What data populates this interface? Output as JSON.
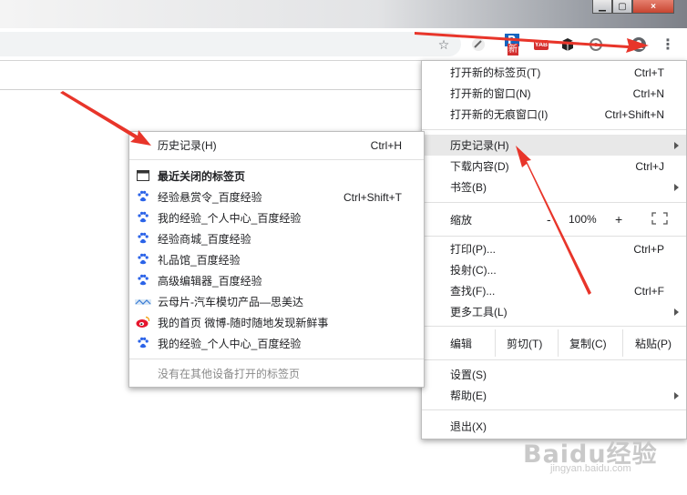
{
  "window": {
    "controls": [
      "minimize",
      "maximize",
      "close"
    ],
    "close_label": "×"
  },
  "toolbar": {
    "icons": [
      "star-icon",
      "ext-pencil-icon",
      "ext-p-icon",
      "ext-yab-icon",
      "ext-cube-icon",
      "ext-circle-icon",
      "profile-icon",
      "menu-icon"
    ],
    "ext_p_badge": "新",
    "ext_yab_label": "YAB",
    "menu_label": "⋮"
  },
  "main_menu": {
    "new_tab": {
      "label": "打开新的标签页(T)",
      "shortcut": "Ctrl+T"
    },
    "new_window": {
      "label": "打开新的窗口(N)",
      "shortcut": "Ctrl+N"
    },
    "new_incognito": {
      "label": "打开新的无痕窗口(I)",
      "shortcut": "Ctrl+Shift+N"
    },
    "history": {
      "label": "历史记录(H)"
    },
    "downloads": {
      "label": "下载内容(D)",
      "shortcut": "Ctrl+J"
    },
    "bookmarks": {
      "label": "书签(B)"
    },
    "zoom": {
      "label": "缩放",
      "minus": "-",
      "value": "100%",
      "plus": "+"
    },
    "print": {
      "label": "打印(P)...",
      "shortcut": "Ctrl+P"
    },
    "cast": {
      "label": "投射(C)..."
    },
    "find": {
      "label": "查找(F)...",
      "shortcut": "Ctrl+F"
    },
    "more_tools": {
      "label": "更多工具(L)"
    },
    "edit": {
      "label": "编辑",
      "cut": "剪切(T)",
      "copy": "复制(C)",
      "paste": "粘贴(P)"
    },
    "settings": {
      "label": "设置(S)"
    },
    "help": {
      "label": "帮助(E)"
    },
    "exit": {
      "label": "退出(X)"
    }
  },
  "history_menu": {
    "history": {
      "label": "历史记录(H)",
      "shortcut": "Ctrl+H"
    },
    "recently_closed": "最近关闭的标签页",
    "entries": [
      {
        "icon": "baidu-paw-icon",
        "label": "经验悬赏令_百度经验",
        "shortcut": "Ctrl+Shift+T"
      },
      {
        "icon": "baidu-paw-icon",
        "label": "我的经验_个人中心_百度经验",
        "shortcut": ""
      },
      {
        "icon": "baidu-paw-icon",
        "label": "经验商城_百度经验",
        "shortcut": ""
      },
      {
        "icon": "baidu-paw-icon",
        "label": "礼品馆_百度经验",
        "shortcut": ""
      },
      {
        "icon": "baidu-paw-icon",
        "label": "高级编辑器_百度经验",
        "shortcut": ""
      },
      {
        "icon": "yunmu-logo-icon",
        "label": "云母片-汽车模切产品—思美达",
        "shortcut": ""
      },
      {
        "icon": "weibo-icon",
        "label": "我的首页 微博-随时随地发现新鲜事",
        "shortcut": ""
      },
      {
        "icon": "baidu-paw-icon",
        "label": "我的经验_个人中心_百度经验",
        "shortcut": ""
      }
    ],
    "other_devices": "没有在其他设备打开的标签页"
  },
  "watermark": {
    "main": "Baidu经验",
    "sub": "jingyan.baidu.com"
  },
  "colors": {
    "arrow_red": "#e8352a",
    "highlight": "#e8e8e8",
    "baidu_blue": "#2b63e8",
    "weibo_red": "#e6162d"
  }
}
